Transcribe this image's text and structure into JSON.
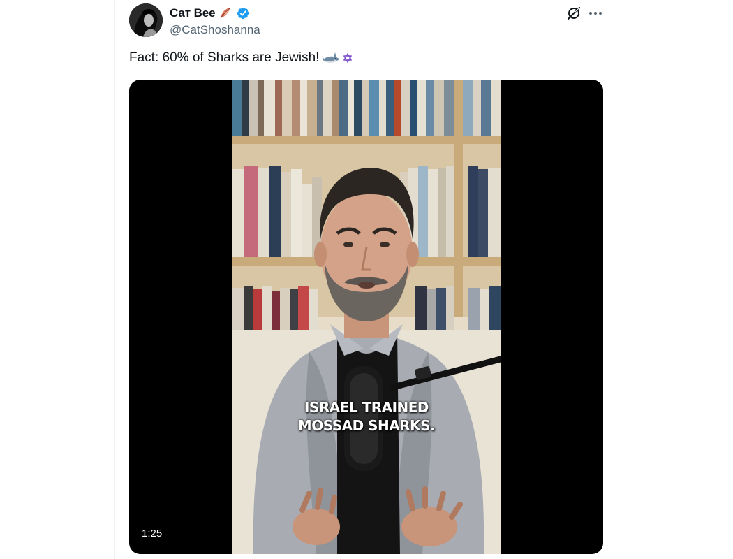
{
  "author": {
    "display_name": "Сат Вее",
    "handle": "@CatShoshanna",
    "badge_color": "#1d9bf0",
    "avatar_icon": "avatar-photo"
  },
  "tweet": {
    "text": "Fact: 60% of Sharks are Jewish!",
    "emojis": [
      "shark-icon",
      "star-of-david-icon"
    ]
  },
  "header_actions": [
    "grok-icon",
    "more-icon"
  ],
  "media": {
    "type": "video",
    "caption": "ISRAEL TRAINED\nMOSSAD SHARKS.",
    "duration": "1:25"
  },
  "colors": {
    "text_primary": "#0f1419",
    "text_secondary": "#536471",
    "verified": "#1d9bf0",
    "media_bg": "#000000"
  }
}
